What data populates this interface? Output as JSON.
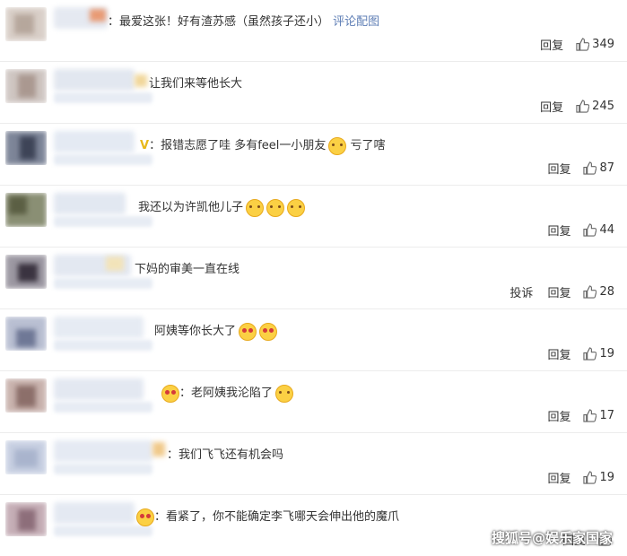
{
  "comments": [
    {
      "text": "最爱这张！好有渣苏感（虽然孩子还小）",
      "link": "评论配图",
      "reply": "回复",
      "likes": "349"
    },
    {
      "text": "让我们来等他长大",
      "reply": "回复",
      "likes": "245"
    },
    {
      "text": "报错志愿了哇 多有feel一小朋友",
      "text2": "亏了嗐",
      "reply": "回复",
      "likes": "87"
    },
    {
      "text": "我还以为许凯他儿子",
      "reply": "回复",
      "likes": "44"
    },
    {
      "text": "下妈的审美一直在线",
      "report": "投诉",
      "reply": "回复",
      "likes": "28"
    },
    {
      "text": "阿姨等你长大了",
      "reply": "回复",
      "likes": "19"
    },
    {
      "text": "老阿姨我沦陷了",
      "reply": "回复",
      "likes": "17"
    },
    {
      "text": "我们飞飞还有机会吗",
      "reply": "回复",
      "likes": "19"
    },
    {
      "text": "看紧了，你不能确定李飞哪天会伸出他的魔爪",
      "reply": "回复",
      "likes": ""
    }
  ],
  "watermark": "搜狐号@娱乐家国家",
  "colors": {
    "link": "#5e7eb5",
    "text": "#333333",
    "separator": "#ececec"
  }
}
